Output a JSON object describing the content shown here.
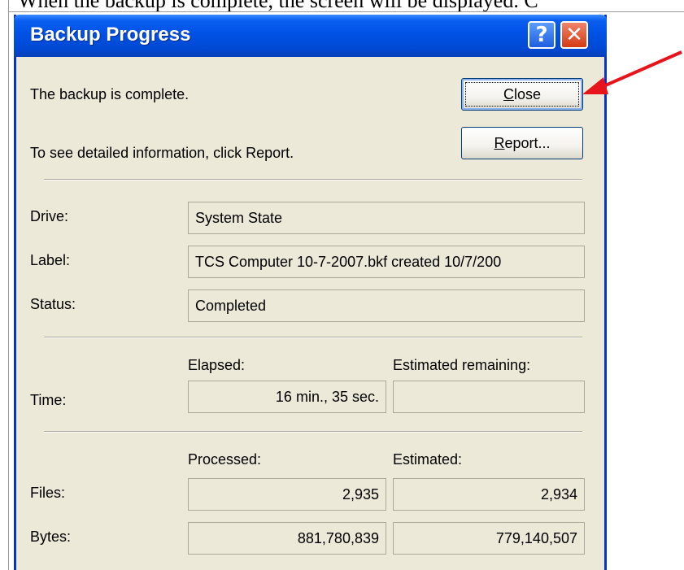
{
  "document": {
    "clipped_line": "When the backup is complete, the screen will be displayed. C"
  },
  "window": {
    "title": "Backup Progress",
    "help_button": "?",
    "close_button": "✕"
  },
  "messages": {
    "complete": "The backup is complete.",
    "report_hint": "To see detailed information, click Report."
  },
  "buttons": {
    "close": {
      "mnemonic": "C",
      "rest": "lose"
    },
    "report": {
      "mnemonic": "R",
      "rest": "eport..."
    }
  },
  "info": {
    "drive_label": "Drive:",
    "drive_value": "System State",
    "label_label": "Label:",
    "label_value": "TCS Computer 10-7-2007.bkf created 10/7/200",
    "status_label": "Status:",
    "status_value": "Completed"
  },
  "time": {
    "row_label": "Time:",
    "elapsed_header": "Elapsed:",
    "remaining_header": "Estimated remaining:",
    "elapsed_value": "16 min., 35 sec.",
    "remaining_value": ""
  },
  "counts": {
    "processed_header": "Processed:",
    "estimated_header": "Estimated:",
    "files_label": "Files:",
    "files_processed": "2,935",
    "files_estimated": "2,934",
    "bytes_label": "Bytes:",
    "bytes_processed": "881,780,839",
    "bytes_estimated": "779,140,507"
  },
  "colors": {
    "title_bar": "#0054e3",
    "dialog_bg": "#ece9d8",
    "annotation_arrow": "#e8141b"
  }
}
